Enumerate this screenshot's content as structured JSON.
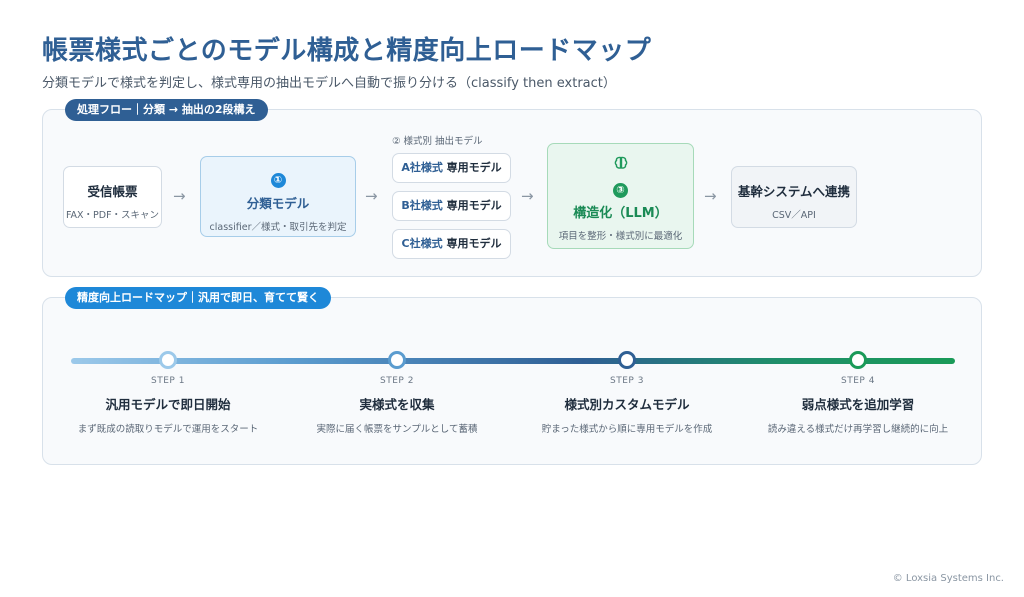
{
  "header": {
    "title": "帳票様式ごとのモデル構成と精度向上ロードマップ",
    "subtitle": "分類モデルで様式を判定し、様式専用の抽出モデルへ自動で振り分ける（classify then extract）"
  },
  "flow": {
    "pill": "処理フロー｜分類 → 抽出の2段構え",
    "receive": {
      "title": "受信帳票",
      "sub": "FAX・PDF・スキャン"
    },
    "classifier": {
      "num": "①",
      "title": "分類モデル",
      "sub": "classifier／様式・取引先を判定"
    },
    "models_label": "② 様式別 抽出モデル",
    "models": [
      {
        "company": "A社様式",
        "suffix": "専用モデル"
      },
      {
        "company": "B社様式",
        "suffix": "専用モデル"
      },
      {
        "company": "C社様式",
        "suffix": "専用モデル"
      }
    ],
    "llm": {
      "num": "③",
      "title": "構造化（LLM）",
      "sub": "項目を整形・様式別に最適化"
    },
    "core": {
      "title": "基幹システムへ連携",
      "sub": "CSV／API"
    },
    "arrow": "→"
  },
  "roadmap": {
    "pill": "精度向上ロードマップ｜汎用で即日、育てて賢く",
    "steps": [
      {
        "label": "STEP 1",
        "title": "汎用モデルで即日開始",
        "desc": "まず既成の読取りモデルで運用をスタート"
      },
      {
        "label": "STEP 2",
        "title": "実様式を収集",
        "desc": "実際に届く帳票をサンプルとして蓄積"
      },
      {
        "label": "STEP 3",
        "title": "様式別カスタムモデル",
        "desc": "貯まった様式から順に専用モデルを作成"
      },
      {
        "label": "STEP 4",
        "title": "弱点様式を追加学習",
        "desc": "読み違える様式だけ再学習し継続的に向上"
      }
    ]
  },
  "footer": {
    "copyright": "© Loxsia Systems Inc."
  }
}
